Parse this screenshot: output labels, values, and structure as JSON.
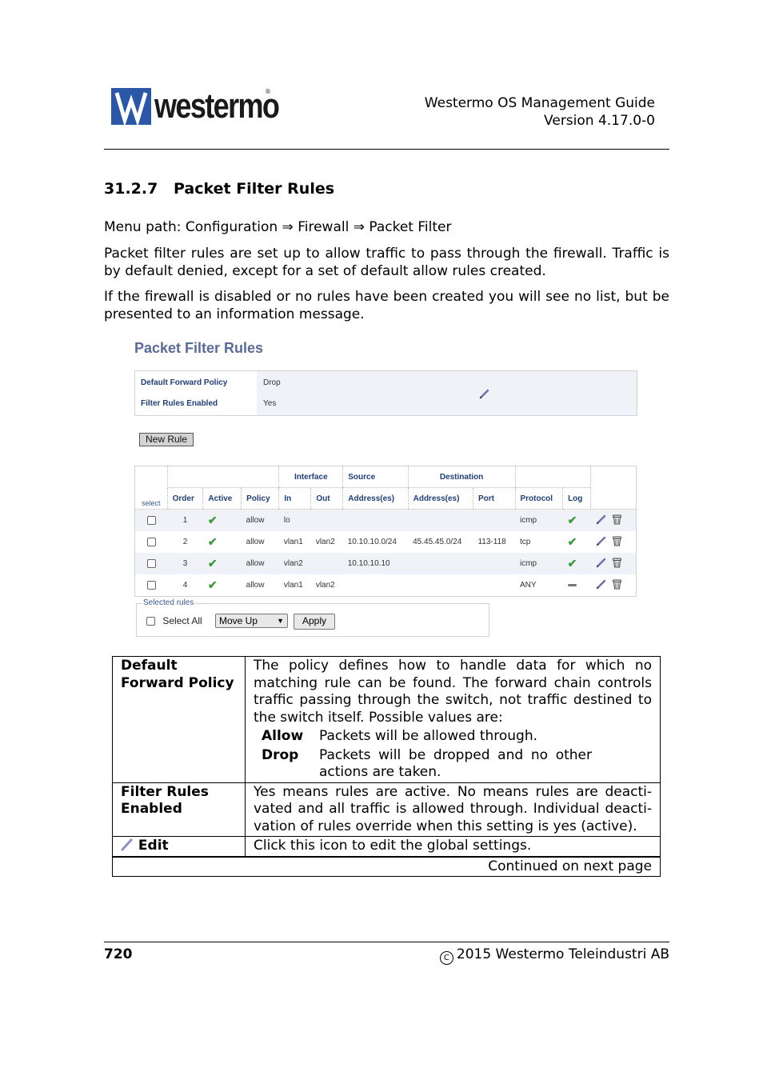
{
  "header": {
    "logo_text": "westermo",
    "logo_reg": "®",
    "doc_title": "Westermo OS Management Guide",
    "version": "Version 4.17.0-0"
  },
  "section": {
    "number": "31.2.7",
    "title": "Packet Filter Rules"
  },
  "paragraphs": {
    "menu_path": "Menu path: Configuration ⇒ Firewall ⇒ Packet Filter",
    "intro": "Packet filter rules are set up to allow traffic to pass through the firewall. Traffic is by default denied, except for a set of default allow rules created.",
    "info": "If the firewall is disabled or no rules have been created you will see no list, but be presented to an information message."
  },
  "ui": {
    "title": "Packet Filter Rules",
    "settings": {
      "default_forward_policy_label": "Default Forward Policy",
      "default_forward_policy_value": "Drop",
      "filter_rules_enabled_label": "Filter Rules Enabled",
      "filter_rules_enabled_value": "Yes",
      "edit_icon": "pencil-icon"
    },
    "new_rule_button": "New Rule",
    "table": {
      "group_headers": {
        "interface": "Interface",
        "source": "Source",
        "destination": "Destination"
      },
      "columns": {
        "select": "select",
        "order": "Order",
        "active": "Active",
        "policy": "Policy",
        "in": "In",
        "out": "Out",
        "src_address": "Address(es)",
        "dst_address": "Address(es)",
        "port": "Port",
        "protocol": "Protocol",
        "log": "Log"
      },
      "rows": [
        {
          "order": "1",
          "active": true,
          "policy": "allow",
          "in": "lo",
          "out": "",
          "src": "",
          "dst": "",
          "port": "",
          "protocol": "icmp",
          "log": true
        },
        {
          "order": "2",
          "active": true,
          "policy": "allow",
          "in": "vlan1",
          "out": "vlan2",
          "src": "10.10.10.0/24",
          "dst": "45.45.45.0/24",
          "port": "113-118",
          "protocol": "tcp",
          "log": true
        },
        {
          "order": "3",
          "active": true,
          "policy": "allow",
          "in": "vlan2",
          "out": "",
          "src": "10.10.10.10",
          "dst": "",
          "port": "",
          "protocol": "icmp",
          "log": true
        },
        {
          "order": "4",
          "active": true,
          "policy": "allow",
          "in": "vlan1",
          "out": "vlan2",
          "src": "",
          "dst": "",
          "port": "",
          "protocol": "ANY",
          "log": false
        }
      ],
      "check_glyph": "✔"
    },
    "selected_rules": {
      "legend": "Selected rules",
      "select_all": "Select All",
      "action_selected": "Move Up",
      "apply": "Apply"
    }
  },
  "description": {
    "rows": [
      {
        "term": "Default Forward Policy",
        "definition": "The policy defines how to handle data for which no matching rule can be found. The forward chain controls traffic passing through the switch, not traffic destined to the switch itself. Possible values are:",
        "values": [
          {
            "key": "Allow",
            "text": "Packets will be allowed through."
          },
          {
            "key": "Drop",
            "text": "Packets will be dropped and no other actions are taken."
          }
        ]
      },
      {
        "term": "Filter Rules Enabled",
        "definition": "Yes means rules are active. No means rules are deacti-vated and all traffic is allowed through. Individual deacti-vation of rules override when this setting is yes (active)."
      },
      {
        "term": "Edit",
        "definition": "Click this icon to edit the global settings."
      }
    ],
    "continued": "Continued on next page"
  },
  "footer": {
    "page_number": "720",
    "copyright_symbol": "C",
    "copyright": "2015 Westermo Teleindustri AB"
  }
}
